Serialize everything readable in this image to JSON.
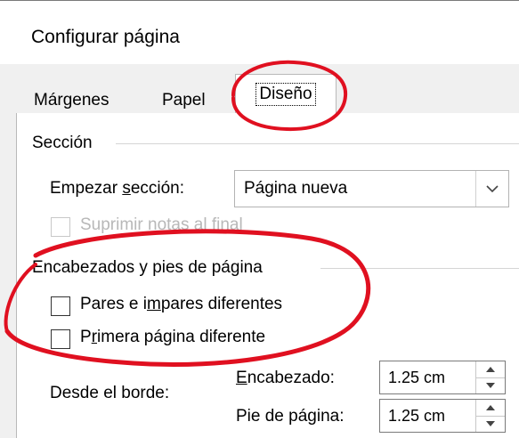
{
  "dialog": {
    "title": "Configurar página"
  },
  "tabs": [
    {
      "label": "Márgenes",
      "selected": false
    },
    {
      "label": "Papel",
      "selected": false
    },
    {
      "label": "Diseño",
      "selected": true
    }
  ],
  "section": {
    "title": "Sección",
    "start_label_pre": "Empezar ",
    "start_label_accel": "s",
    "start_label_post": "ección:",
    "start_value": "Página nueva",
    "suppress_endnotes": {
      "label": "Suprimir notas al final",
      "checked": false,
      "enabled": false
    }
  },
  "headers_footers": {
    "title": "Encabezados y pies de página",
    "odd_even": {
      "pre": "Pares e i",
      "accel": "m",
      "post": "pares diferentes",
      "checked": false
    },
    "first_page": {
      "pre": "P",
      "accel": "r",
      "post": "imera página diferente",
      "checked": false
    },
    "from_edge_label": "Desde el borde:",
    "header": {
      "accel": "E",
      "post": "ncabezado:",
      "value": "1.25 cm"
    },
    "footer": {
      "pre": "Pie de pá",
      "accel": "g",
      "post": "ina:",
      "value": "1.25 cm"
    }
  },
  "colors": {
    "annotation": "#e01020",
    "selected_tab_bg": "#ffffff",
    "dialog_bg": "#f0f0f0"
  }
}
